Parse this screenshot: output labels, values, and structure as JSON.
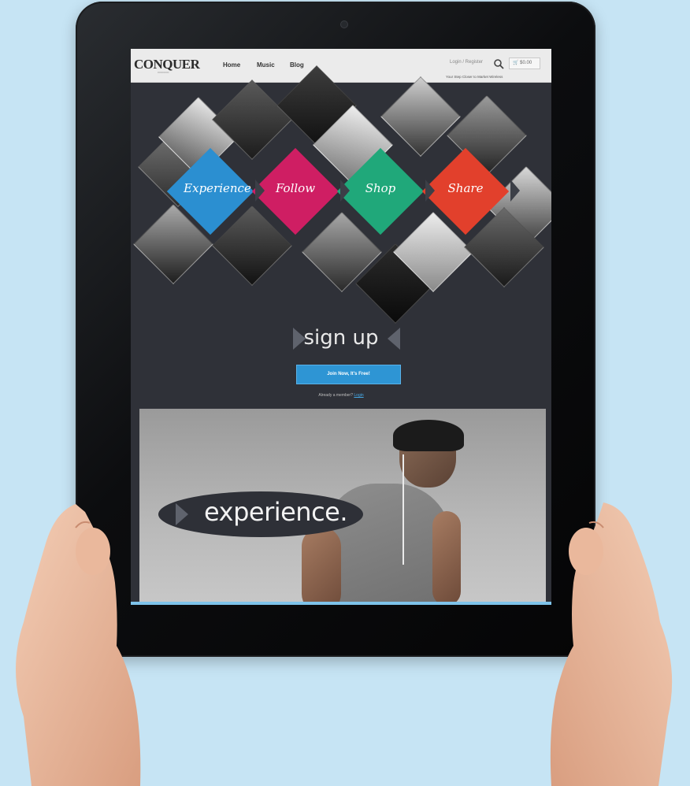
{
  "header": {
    "logo": "CONQUER",
    "nav": [
      "Home",
      "Music",
      "Blog"
    ],
    "login_text": "Login / Register",
    "cart_text": "$0.00",
    "tagline": "Your Step Closer to Market Wireless"
  },
  "diamonds": [
    {
      "label": "Experience",
      "color": "#2b8fd1"
    },
    {
      "label": "Follow",
      "color": "#cf1e63"
    },
    {
      "label": "Shop",
      "color": "#20a87a"
    },
    {
      "label": "Share",
      "color": "#e2402c"
    }
  ],
  "signup": {
    "title": "sign up",
    "button_label": "Join Now, It's Free!",
    "already_text": "Already a member?",
    "login_link": "Login"
  },
  "hero": {
    "headline": "experience."
  }
}
